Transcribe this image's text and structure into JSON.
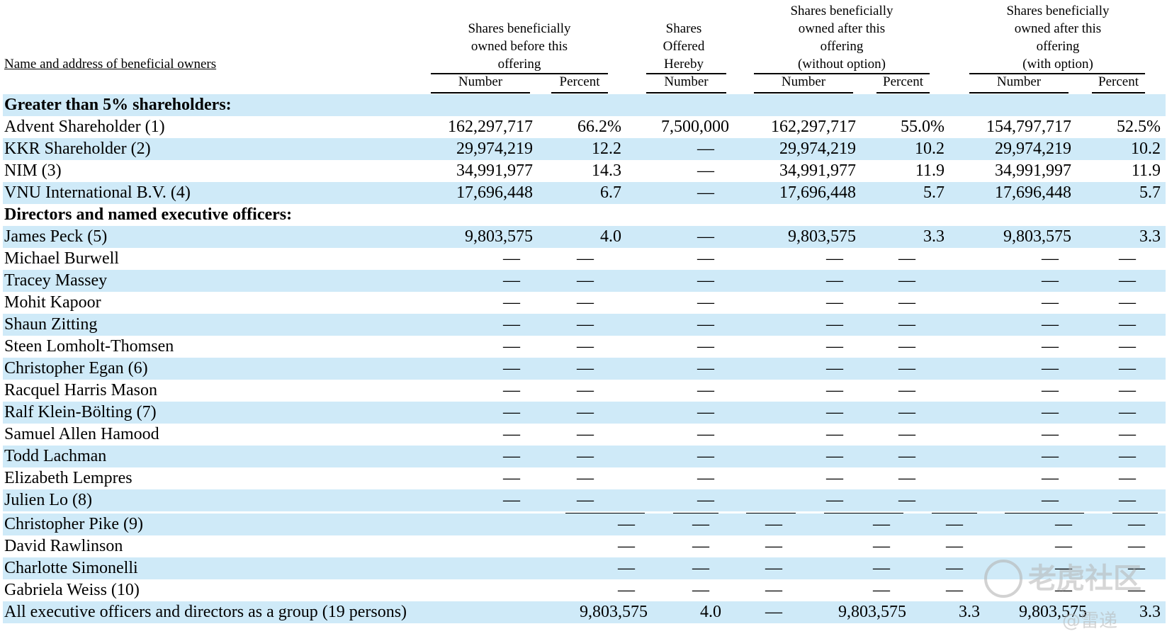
{
  "headers": {
    "owner": "Name and address of beneficial owners",
    "before": [
      "Shares beneficially",
      "owned before this",
      "offering"
    ],
    "offered": [
      "Shares",
      "Offered",
      "Hereby"
    ],
    "after_without": [
      "Shares beneficially",
      "owned after this",
      "offering",
      "(without option)"
    ],
    "after_with": [
      "Shares beneficially",
      "owned after this",
      "offering",
      "(with option)"
    ],
    "sub": {
      "number": "Number",
      "percent": "Percent"
    }
  },
  "sections": {
    "greater": "Greater than 5% shareholders:",
    "directors": "Directors and named executive officers:"
  },
  "rows_a": [
    {
      "name": "Advent Shareholder (1)",
      "v": [
        "162,297,717",
        "66.2%",
        "7,500,000",
        "162,297,717",
        "55.0%",
        "154,797,717",
        "52.5%"
      ]
    },
    {
      "name": "KKR Shareholder (2)",
      "v": [
        "29,974,219",
        "12.2",
        "—",
        "29,974,219",
        "10.2",
        "29,974,219",
        "10.2"
      ]
    },
    {
      "name": "NIM (3)",
      "v": [
        "34,991,977",
        "14.3",
        "—",
        "34,991,977",
        "11.9",
        "34,991,997",
        "11.9"
      ]
    },
    {
      "name": "VNU International B.V. (4)",
      "v": [
        "17,696,448",
        "6.7",
        "—",
        "17,696,448",
        "5.7",
        "17,696,448",
        "5.7"
      ]
    }
  ],
  "rows_b": [
    {
      "name": "James Peck (5)",
      "v": [
        "9,803,575",
        "4.0",
        "—",
        "9,803,575",
        "3.3",
        "9,803,575",
        "3.3"
      ]
    },
    {
      "name": "Michael Burwell",
      "v": [
        "—",
        "—",
        "—",
        "—",
        "—",
        "—",
        "—"
      ]
    },
    {
      "name": "Tracey Massey",
      "v": [
        "—",
        "—",
        "—",
        "—",
        "—",
        "—",
        "—"
      ]
    },
    {
      "name": "Mohit Kapoor",
      "v": [
        "—",
        "—",
        "—",
        "—",
        "—",
        "—",
        "—"
      ]
    },
    {
      "name": "Shaun Zitting",
      "v": [
        "—",
        "—",
        "—",
        "—",
        "—",
        "—",
        "—"
      ]
    },
    {
      "name": "Steen Lomholt-Thomsen",
      "v": [
        "—",
        "—",
        "—",
        "—",
        "—",
        "—",
        "—"
      ]
    },
    {
      "name": "Christopher Egan (6)",
      "v": [
        "—",
        "—",
        "—",
        "—",
        "—",
        "—",
        "—"
      ]
    },
    {
      "name": "Racquel Harris Mason",
      "v": [
        "—",
        "—",
        "—",
        "—",
        "—",
        "—",
        "—"
      ]
    },
    {
      "name": "Ralf Klein-Bölting (7)",
      "v": [
        "—",
        "—",
        "—",
        "—",
        "—",
        "—",
        "—"
      ]
    },
    {
      "name": "Samuel Allen Hamood",
      "v": [
        "—",
        "—",
        "—",
        "—",
        "—",
        "—",
        "—"
      ]
    },
    {
      "name": "Todd Lachman",
      "v": [
        "—",
        "—",
        "—",
        "—",
        "—",
        "—",
        "—"
      ]
    },
    {
      "name": "Elizabeth Lempres",
      "v": [
        "—",
        "—",
        "—",
        "—",
        "—",
        "—",
        "—"
      ]
    },
    {
      "name": "Julien Lo (8)",
      "v": [
        "—",
        "—",
        "—",
        "—",
        "—",
        "—",
        "—"
      ]
    }
  ],
  "rows_c": [
    {
      "name": "Christopher Pike (9)",
      "v": [
        "—",
        "—",
        "—",
        "—",
        "—",
        "—",
        "—"
      ]
    },
    {
      "name": "David Rawlinson",
      "v": [
        "—",
        "—",
        "—",
        "—",
        "—",
        "—",
        "—"
      ]
    },
    {
      "name": "Charlotte Simonelli",
      "v": [
        "—",
        "—",
        "—",
        "—",
        "—",
        "—",
        "—"
      ]
    },
    {
      "name": "Gabriela Weiss (10)",
      "v": [
        "—",
        "—",
        "—",
        "—",
        "—",
        "—",
        "—"
      ]
    },
    {
      "name": "All executive officers and directors as a group (19 persons)",
      "v": [
        "9,803,575",
        "4.0",
        "—",
        "9,803,575",
        "3.3",
        "9,803,575",
        "3.3"
      ]
    }
  ],
  "watermark": {
    "brand": "老虎社区",
    "author": "@雷递"
  },
  "colors": {
    "row_shade": "#cfeaf8"
  }
}
